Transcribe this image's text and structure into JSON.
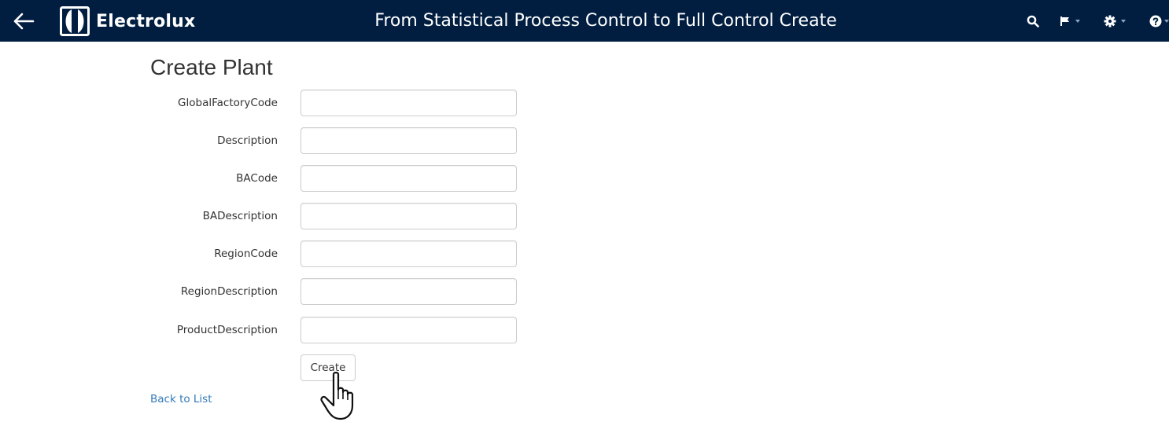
{
  "colors": {
    "header_bg": "#011e41",
    "link": "#337ab7",
    "text": "#333333",
    "input_border": "#cccccc"
  },
  "header": {
    "brand_name": "Electrolux",
    "title": "From Statistical Process Control to Full Control Create",
    "icons": [
      "back-arrow-icon",
      "electrolux-logo-icon",
      "search-icon",
      "flag-icon",
      "gear-icon",
      "help-icon"
    ]
  },
  "page": {
    "heading": "Create Plant"
  },
  "form": {
    "fields": [
      {
        "label": "GlobalFactoryCode",
        "value": "",
        "placeholder": ""
      },
      {
        "label": "Description",
        "value": "",
        "placeholder": ""
      },
      {
        "label": "BACode",
        "value": "",
        "placeholder": ""
      },
      {
        "label": "BADescription",
        "value": "",
        "placeholder": ""
      },
      {
        "label": "RegionCode",
        "value": "",
        "placeholder": ""
      },
      {
        "label": "RegionDescription",
        "value": "",
        "placeholder": ""
      },
      {
        "label": "ProductDescription",
        "value": "",
        "placeholder": ""
      }
    ],
    "submit_label": "Create"
  },
  "back_link": "Back to List"
}
